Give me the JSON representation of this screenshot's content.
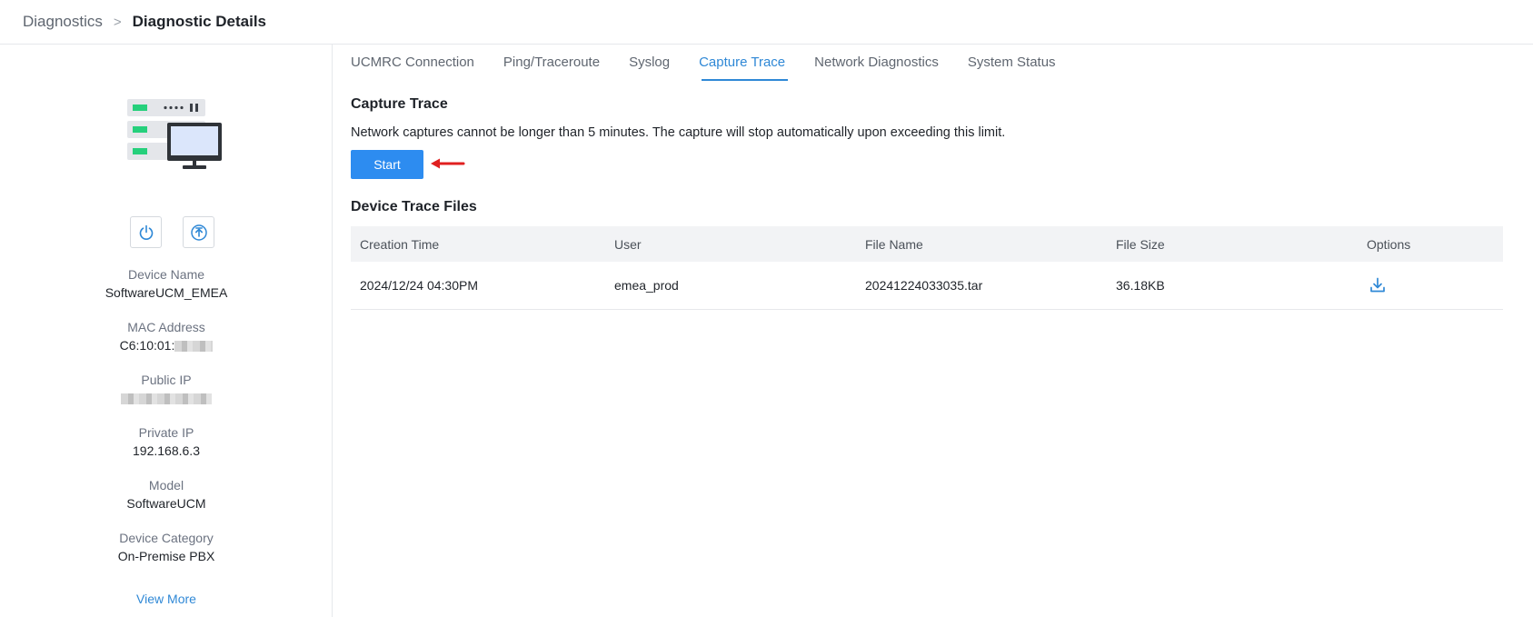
{
  "breadcrumb": {
    "parent": "Diagnostics",
    "separator": ">",
    "current": "Diagnostic Details"
  },
  "sidebar": {
    "device_icon": "server-monitor-icon",
    "actions": [
      {
        "icon": "power-icon"
      },
      {
        "icon": "upload-icon"
      }
    ],
    "fields": {
      "device_name": {
        "label": "Device Name",
        "value": "SoftwareUCM_EMEA"
      },
      "mac_address": {
        "label": "MAC Address",
        "value": "C6:10:01:"
      },
      "public_ip": {
        "label": "Public IP",
        "value": ""
      },
      "private_ip": {
        "label": "Private IP",
        "value": "192.168.6.3"
      },
      "model": {
        "label": "Model",
        "value": "SoftwareUCM"
      },
      "device_category": {
        "label": "Device Category",
        "value": "On-Premise PBX"
      }
    },
    "view_more": "View More"
  },
  "tabs": [
    {
      "label": "UCMRC Connection"
    },
    {
      "label": "Ping/Traceroute"
    },
    {
      "label": "Syslog"
    },
    {
      "label": "Capture Trace"
    },
    {
      "label": "Network Diagnostics"
    },
    {
      "label": "System Status"
    }
  ],
  "active_tab": "Capture Trace",
  "capture": {
    "title": "Capture Trace",
    "note": "Network captures cannot be longer than 5 minutes. The capture will stop automatically upon exceeding this limit.",
    "start_label": "Start"
  },
  "files": {
    "title": "Device Trace Files",
    "columns": [
      "Creation Time",
      "User",
      "File Name",
      "File Size",
      "Options"
    ],
    "rows": [
      {
        "creation_time": "2024/12/24 04:30PM",
        "user": "emea_prod",
        "file_name": "20241224033035.tar",
        "file_size": "36.18KB",
        "option_icon": "download-icon"
      }
    ]
  },
  "colors": {
    "accent": "#2f88d6",
    "button": "#2d8cf0",
    "arrow": "#e02020"
  }
}
